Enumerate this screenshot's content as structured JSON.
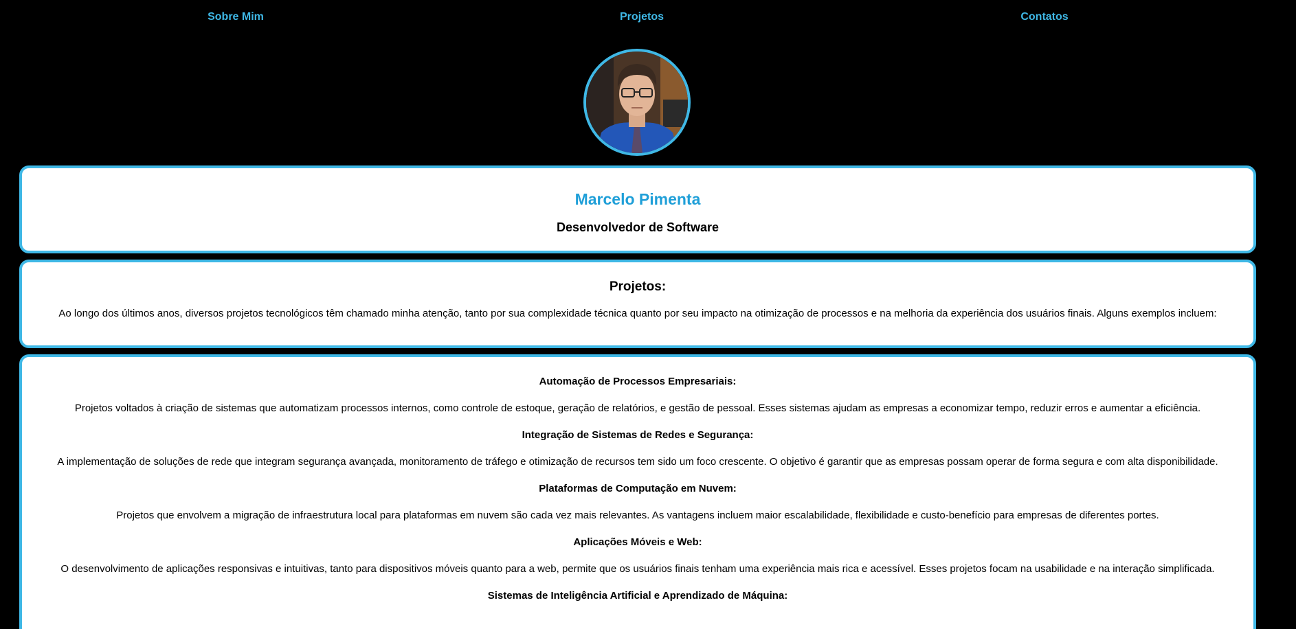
{
  "nav": {
    "items": [
      "Sobre Mim",
      "Projetos",
      "Contatos"
    ]
  },
  "profile": {
    "name": "Marcelo Pimenta",
    "role": "Desenvolvedor de Software"
  },
  "projects": {
    "title": "Projetos:",
    "intro": "Ao longo dos últimos anos, diversos projetos tecnológicos têm chamado minha atenção, tanto por sua complexidade técnica quanto por seu impacto na otimização de processos e na melhoria da experiência dos usuários finais. Alguns exemplos incluem:"
  },
  "project_list": [
    {
      "title": "Automação de Processos Empresariais:",
      "text": "Projetos voltados à criação de sistemas que automatizam processos internos, como controle de estoque, geração de relatórios, e gestão de pessoal. Esses sistemas ajudam as empresas a economizar tempo, reduzir erros e aumentar a eficiência."
    },
    {
      "title": "Integração de Sistemas de Redes e Segurança:",
      "text": "A implementação de soluções de rede que integram segurança avançada, monitoramento de tráfego e otimização de recursos tem sido um foco crescente. O objetivo é garantir que as empresas possam operar de forma segura e com alta disponibilidade."
    },
    {
      "title": "Plataformas de Computação em Nuvem:",
      "text": "Projetos que envolvem a migração de infraestrutura local para plataformas em nuvem são cada vez mais relevantes. As vantagens incluem maior escalabilidade, flexibilidade e custo-benefício para empresas de diferentes portes."
    },
    {
      "title": "Aplicações Móveis e Web:",
      "text": "O desenvolvimento de aplicações responsivas e intuitivas, tanto para dispositivos móveis quanto para a web, permite que os usuários finais tenham uma experiência mais rica e acessível. Esses projetos focam na usabilidade e na interação simplificada."
    },
    {
      "title": "Sistemas de Inteligência Artificial e Aprendizado de Máquina:",
      "text": ""
    }
  ],
  "colors": {
    "background": "#000000",
    "accent": "#3fb8e6",
    "name": "#1f9fd8",
    "card": "#ffffff"
  }
}
